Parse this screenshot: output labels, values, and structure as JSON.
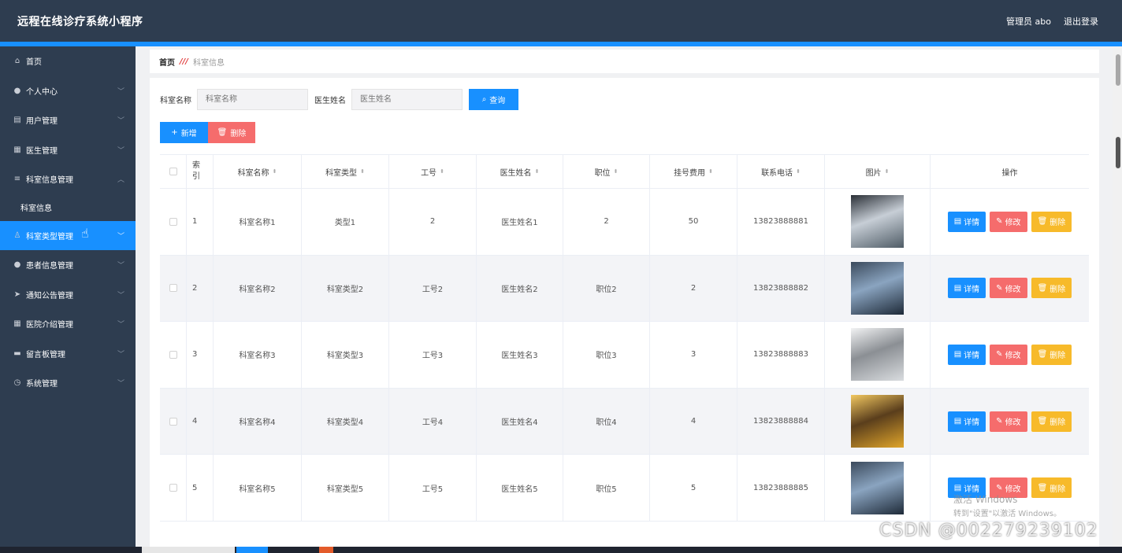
{
  "header": {
    "title": "远程在线诊疗系统小程序",
    "admin": "管理员 abo",
    "logout": "退出登录"
  },
  "sidebar": {
    "items": [
      {
        "label": "首页",
        "icon": "home-icon",
        "glyph": "⌂",
        "chevron": false
      },
      {
        "label": "个人中心",
        "icon": "user-icon",
        "glyph": "●",
        "chevron": true
      },
      {
        "label": "用户管理",
        "icon": "doc-icon",
        "glyph": "▤",
        "chevron": true
      },
      {
        "label": "医生管理",
        "icon": "grid-icon",
        "glyph": "▦",
        "chevron": true
      },
      {
        "label": "科室信息管理",
        "icon": "list-icon",
        "glyph": "≡",
        "chevron": true,
        "expanded": true
      },
      {
        "label": "科室信息",
        "sub": true
      },
      {
        "label": "科室类型管理",
        "icon": "bell-icon",
        "glyph": "♙",
        "chevron": true,
        "active": true
      },
      {
        "label": "患者信息管理",
        "icon": "user-icon",
        "glyph": "●",
        "chevron": true
      },
      {
        "label": "通知公告管理",
        "icon": "send-icon",
        "glyph": "➤",
        "chevron": true
      },
      {
        "label": "医院介绍管理",
        "icon": "grid-icon",
        "glyph": "▦",
        "chevron": true
      },
      {
        "label": "留言板管理",
        "icon": "message-icon",
        "glyph": "▬",
        "chevron": true
      },
      {
        "label": "系统管理",
        "icon": "clock-icon",
        "glyph": "◷",
        "chevron": true
      }
    ]
  },
  "breadcrumb": {
    "home": "首页",
    "separator": "///",
    "current": "科室信息"
  },
  "search": {
    "dept_label": "科室名称",
    "dept_placeholder": "科室名称",
    "doctor_label": "医生姓名",
    "doctor_placeholder": "医生姓名",
    "query_label": "查询"
  },
  "actions": {
    "add_label": "新增",
    "delete_label": "删除"
  },
  "table": {
    "headers": [
      "索引",
      "科室名称",
      "科室类型",
      "工号",
      "医生姓名",
      "职位",
      "挂号费用",
      "联系电话",
      "图片",
      "操作"
    ],
    "rows": [
      {
        "idx": "1",
        "name": "科室名称1",
        "type": "类型1",
        "no": "2",
        "doctor": "医生姓名1",
        "pos": "2",
        "fee": "50",
        "tel": "13823888881",
        "thumb": [
          "#4f5c66",
          "#c7ced6",
          "#2a2f36"
        ]
      },
      {
        "idx": "2",
        "name": "科室名称2",
        "type": "科室类型2",
        "no": "工号2",
        "doctor": "医生姓名2",
        "pos": "职位2",
        "fee": "2",
        "tel": "13823888882",
        "thumb": [
          "#1e2a38",
          "#8aa4c0",
          "#3b4a5c"
        ]
      },
      {
        "idx": "3",
        "name": "科室名称3",
        "type": "科室类型3",
        "no": "工号3",
        "doctor": "医生姓名3",
        "pos": "职位3",
        "fee": "3",
        "tel": "13823888883",
        "thumb": [
          "#d9dcdf",
          "#8b8f94",
          "#f2f3f4"
        ]
      },
      {
        "idx": "4",
        "name": "科室名称4",
        "type": "科室类型4",
        "no": "工号4",
        "doctor": "医生姓名4",
        "pos": "职位4",
        "fee": "4",
        "tel": "13823888884",
        "thumb": [
          "#e0a52a",
          "#5a3e1c",
          "#f2c860"
        ]
      },
      {
        "idx": "5",
        "name": "科室名称5",
        "type": "科室类型5",
        "no": "工号5",
        "doctor": "医生姓名5",
        "pos": "职位5",
        "fee": "5",
        "tel": "13823888885",
        "thumb": [
          "#1e2a38",
          "#8aa4c0",
          "#3b4a5c"
        ]
      }
    ],
    "row_actions": {
      "detail": "详情",
      "edit": "修改",
      "delete": "删除"
    }
  },
  "watermarks": {
    "activate_title": "激活 Windows",
    "activate_hint": "转到\"设置\"以激活 Windows。",
    "csdn": "CSDN @002279239102"
  },
  "colors": {
    "primary": "#1890ff",
    "danger": "#f56c6c",
    "warning": "#f7ba2a",
    "sidebar": "#2e3d50"
  }
}
